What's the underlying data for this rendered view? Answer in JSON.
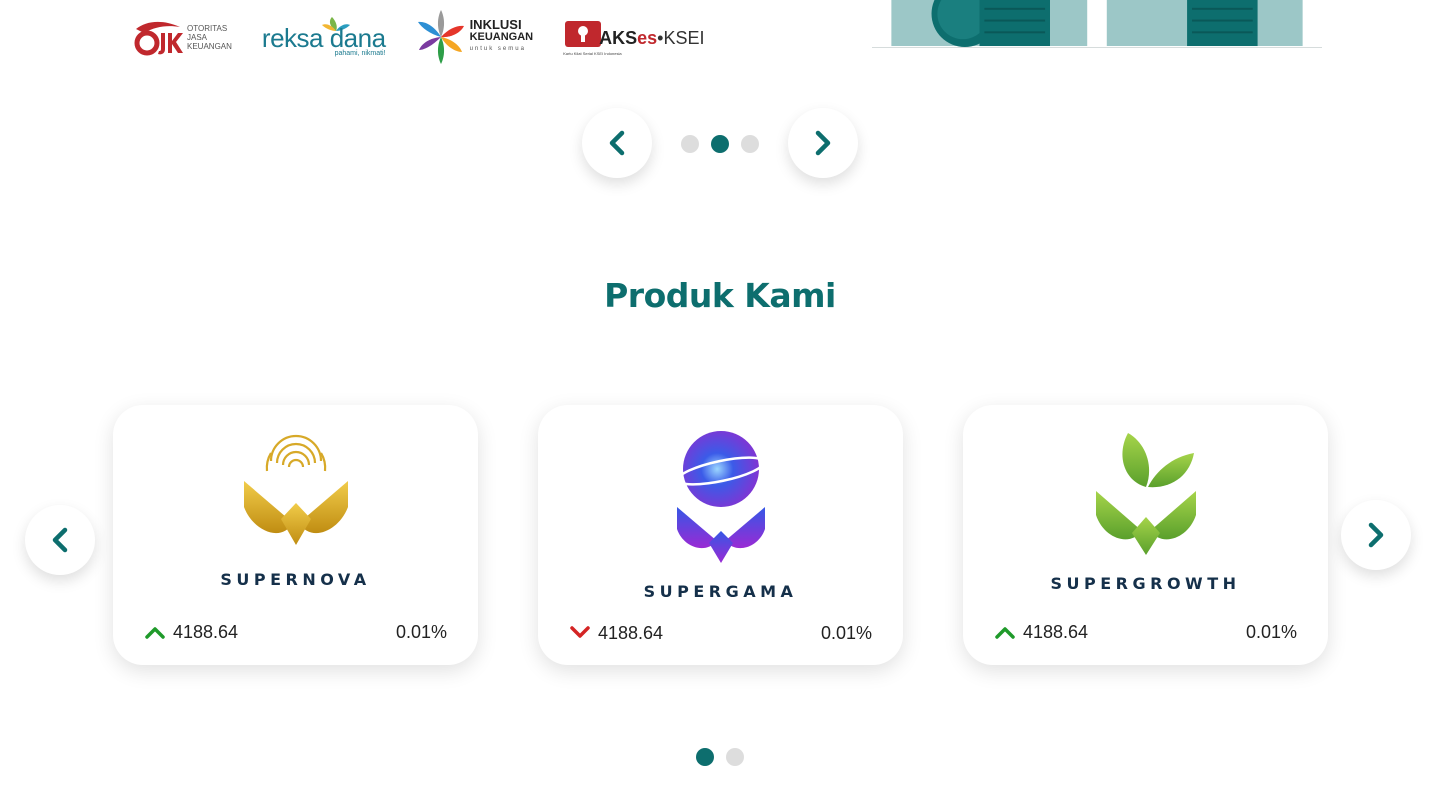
{
  "partners": {
    "ojk": {
      "mark": "OJK",
      "lines": [
        "OTORITAS",
        "JASA",
        "KEUANGAN"
      ]
    },
    "reksa_dana": {
      "name": "reksa dana",
      "tagline": "pahami, nikmati!"
    },
    "inklusi": {
      "line1": "INKLUSI",
      "line2": "KEUANGAN",
      "line3": "untuk semua"
    },
    "akses": {
      "part1": "AKS",
      "part2": "es",
      "part3": "•KSEI",
      "tagline": "Kartu Kilat Serial KSEI Indonesia"
    }
  },
  "hero_carousel": {
    "dots_total": 3,
    "active_dot": 2
  },
  "section": {
    "title": "Produk Kami"
  },
  "products": [
    {
      "name": "SUPERNOVA",
      "trend": "up",
      "value": "4188.64",
      "change": "0.01%"
    },
    {
      "name": "SUPERGAMA",
      "trend": "down",
      "value": "4188.64",
      "change": "0.01%"
    },
    {
      "name": "SUPERGROWTH",
      "trend": "up",
      "value": "4188.64",
      "change": "0.01%"
    }
  ],
  "products_carousel": {
    "dots_total": 2,
    "active_dot": 1
  },
  "colors": {
    "brand_teal": "#0d6e6e",
    "trend_up": "#1f9a2a",
    "trend_down": "#d42424",
    "dot_inactive": "#dddddd"
  },
  "icons": {
    "prev": "chevron-left-icon",
    "next": "chevron-right-icon",
    "up": "chevron-up-icon",
    "down": "chevron-down-icon"
  }
}
